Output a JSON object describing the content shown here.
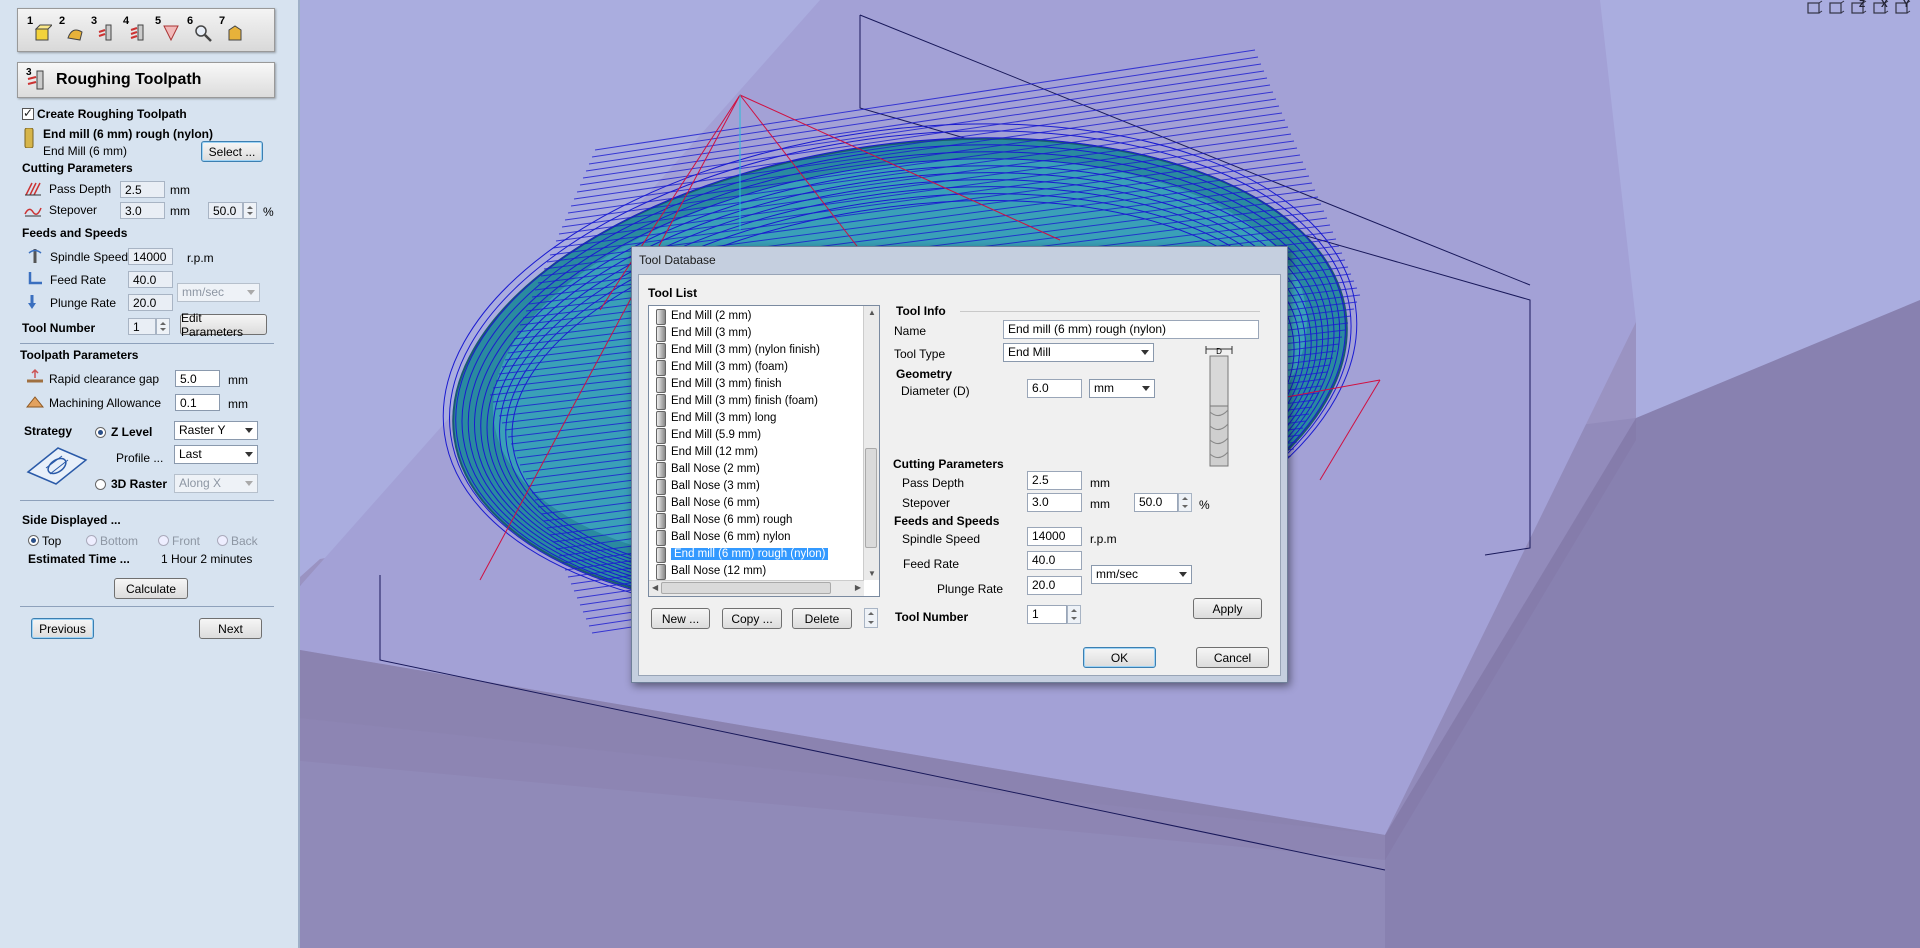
{
  "left_panel": {
    "steps": [
      "1",
      "2",
      "3",
      "4",
      "5",
      "6",
      "7"
    ],
    "title": "Roughing Toolpath",
    "title_step": "3",
    "create_label": "Create Roughing Toolpath",
    "create_checked": true,
    "tool_name": "End mill (6 mm) rough (nylon)",
    "tool_type": "End Mill (6 mm)",
    "select_label": "Select ...",
    "cutting_header": "Cutting Parameters",
    "pass_depth_label": "Pass Depth",
    "pass_depth_value": "2.5",
    "pass_depth_unit": "mm",
    "stepover_label": "Stepover",
    "stepover_value": "3.0",
    "stepover_unit": "mm",
    "stepover_pct": "50.0",
    "pct_unit": "%",
    "feeds_header": "Feeds and Speeds",
    "spindle_label": "Spindle Speed",
    "spindle_value": "14000",
    "spindle_unit": "r.p.m",
    "feed_label": "Feed Rate",
    "feed_value": "40.0",
    "plunge_label": "Plunge Rate",
    "plunge_value": "20.0",
    "rate_unit": "mm/sec",
    "tool_number_label": "Tool Number",
    "tool_number_value": "1",
    "edit_params_label": "Edit Parameters",
    "toolpath_header": "Toolpath Parameters",
    "rapid_label": "Rapid clearance gap",
    "rapid_value": "5.0",
    "rapid_unit": "mm",
    "allowance_label": "Machining Allowance",
    "allowance_value": "0.1",
    "allowance_unit": "mm",
    "strategy_label": "Strategy",
    "zlevel_label": "Z Level",
    "zlevel_option": "Raster Y",
    "profile_label": "Profile ...",
    "profile_option": "Last",
    "raster3d_label": "3D Raster",
    "raster3d_option": "Along X",
    "side_header": "Side Displayed ...",
    "side_top": "Top",
    "side_bottom": "Bottom",
    "side_front": "Front",
    "side_back": "Back",
    "estimated_label": "Estimated Time ...",
    "estimated_value": "1 Hour 2 minutes",
    "calculate_label": "Calculate",
    "previous_label": "Previous",
    "next_label": "Next"
  },
  "view_icons": [
    "fit-view-icon",
    "iso-view-icon",
    "z-top-view-icon",
    "x-view-icon",
    "y-view-icon"
  ],
  "view_icon_letters": [
    "",
    "",
    "Z",
    "X",
    "Y"
  ],
  "dialog": {
    "title": "Tool Database",
    "tool_list_header": "Tool List",
    "tools": [
      "End Mill (2 mm)",
      "End Mill (3 mm)",
      "End Mill (3 mm) (nylon finish)",
      "End Mill (3 mm) (foam)",
      "End Mill (3 mm) finish",
      "End Mill (3 mm) finish (foam)",
      "End Mill (3 mm) long",
      "End Mill (5.9 mm)",
      "End Mill (12 mm)",
      "Ball Nose (2 mm)",
      "Ball Nose (3 mm)",
      "Ball Nose (6 mm)",
      "Ball Nose (6 mm) rough",
      "Ball Nose (6 mm) nylon",
      "End mill (6 mm) rough (nylon)",
      "Ball Nose (12 mm)"
    ],
    "selected_index": 14,
    "new_label": "New ...",
    "copy_label": "Copy ...",
    "delete_label": "Delete",
    "tool_info_header": "Tool Info",
    "name_label": "Name",
    "name_value": "End mill (6 mm) rough (nylon)",
    "tool_type_label": "Tool Type",
    "tool_type_value": "End Mill",
    "geometry_header": "Geometry",
    "diameter_label": "Diameter (D)",
    "diameter_value": "6.0",
    "diameter_unit": "mm",
    "diagram_label": "D",
    "cutting_header": "Cutting Parameters",
    "pass_depth_label": "Pass Depth",
    "pass_depth_value": "2.5",
    "pass_depth_unit": "mm",
    "stepover_label": "Stepover",
    "stepover_value": "3.0",
    "stepover_unit": "mm",
    "stepover_pct": "50.0",
    "pct_unit": "%",
    "feeds_header": "Feeds and Speeds",
    "spindle_label": "Spindle Speed",
    "spindle_value": "14000",
    "spindle_unit": "r.p.m",
    "feed_label": "Feed Rate",
    "feed_value": "40.0",
    "rate_unit": "mm/sec",
    "plunge_label": "Plunge Rate",
    "plunge_value": "20.0",
    "apply_label": "Apply",
    "tool_number_label": "Tool Number",
    "tool_number_value": "1",
    "ok_label": "OK",
    "cancel_label": "Cancel"
  },
  "colors": {
    "panel_bg": "#d7e3f0",
    "viewport_bg": "#aaaddf",
    "toolpath_blue": "#1a1ad0",
    "toolpath_red": "#d01040",
    "model_teal": "#2a8aa0",
    "selection": "#3399ff"
  }
}
